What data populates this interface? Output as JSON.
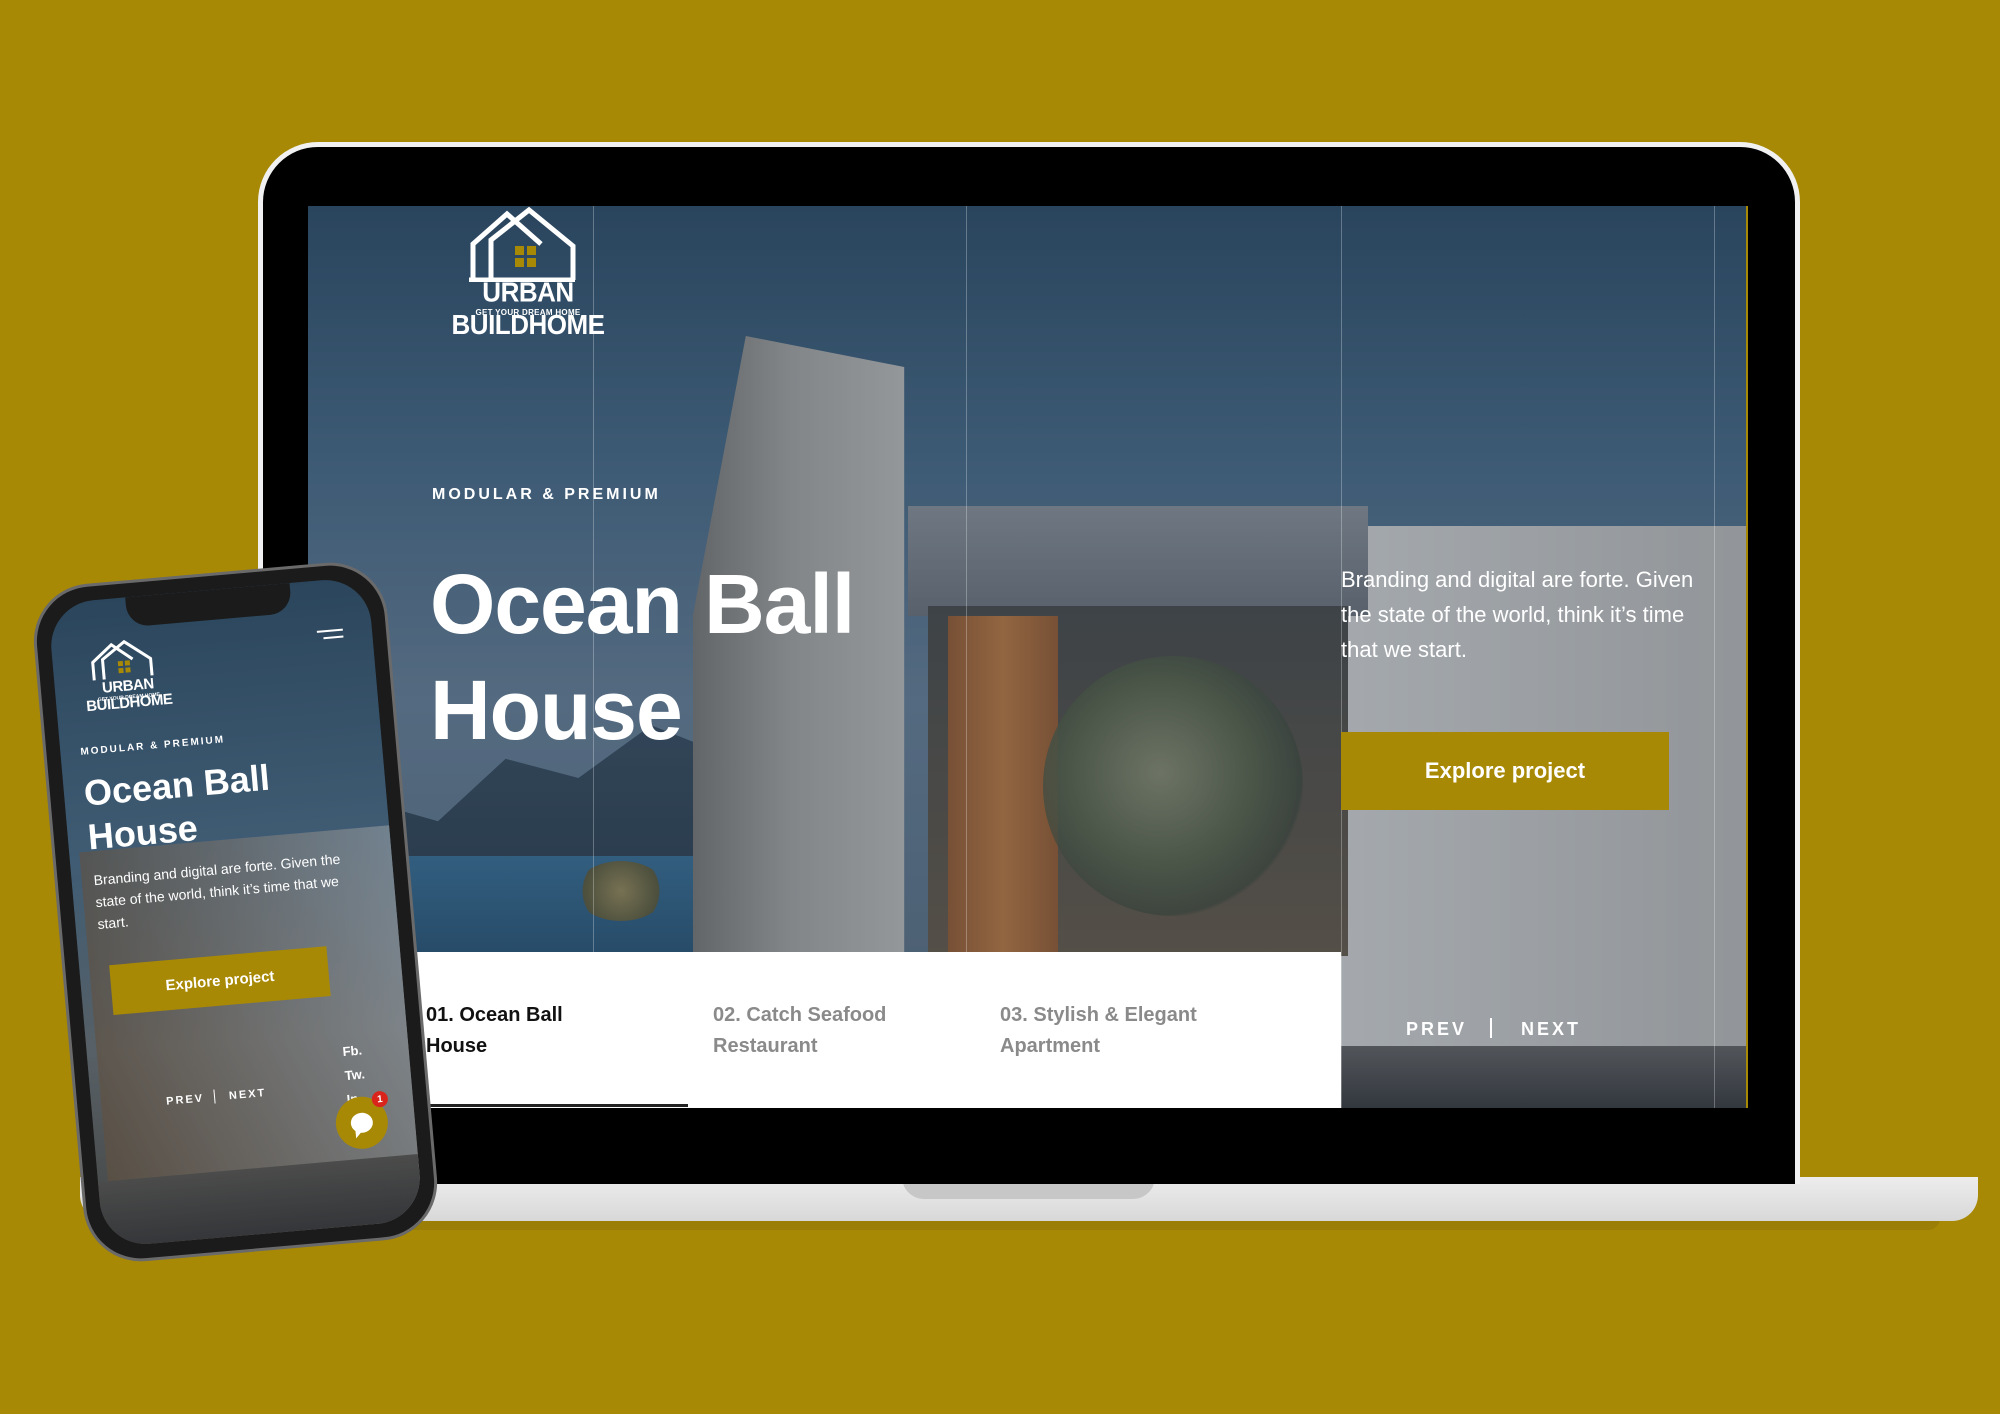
{
  "colors": {
    "background": "#A88905",
    "accent": "#A88905",
    "text_light": "#FFFFFF",
    "tab_active": "#111111",
    "tab_inactive": "#8A8A8A",
    "badge": "#D9241C"
  },
  "brand": {
    "name": "URBAN BUILDHOME",
    "tagline": "GET YOUR DREAM HOME",
    "icon": "house-logo-icon"
  },
  "desktop": {
    "eyebrow": "MODULAR & PREMIUM",
    "title_line1": "Ocean Ball",
    "title_line2": "House",
    "description": "Branding and digital are forte. Given the state of the world, think it’s time that we start.",
    "cta_label": "Explore project",
    "tabs": [
      {
        "label_line1": "01. Ocean Ball",
        "label_line2": "House",
        "active": true
      },
      {
        "label_line1": "02. Catch Seafood",
        "label_line2": "Restaurant",
        "active": false
      },
      {
        "label_line1": "03. Stylish & Elegant",
        "label_line2": "Apartment",
        "active": false
      }
    ],
    "prev_label": "PREV",
    "next_label": "NEXT"
  },
  "mobile": {
    "menu_icon": "hamburger-menu-icon",
    "eyebrow": "MODULAR & PREMIUM",
    "title_line1": "Ocean Ball",
    "title_line2": "House",
    "description": "Branding and digital are forte. Given the state of the world, think it’s time that we start.",
    "cta_label": "Explore project",
    "social": [
      "Fb.",
      "Tw.",
      "In."
    ],
    "prev_label": "PREV",
    "next_label": "NEXT",
    "chat_icon": "chat-bubble-icon",
    "chat_badge_count": "1"
  }
}
